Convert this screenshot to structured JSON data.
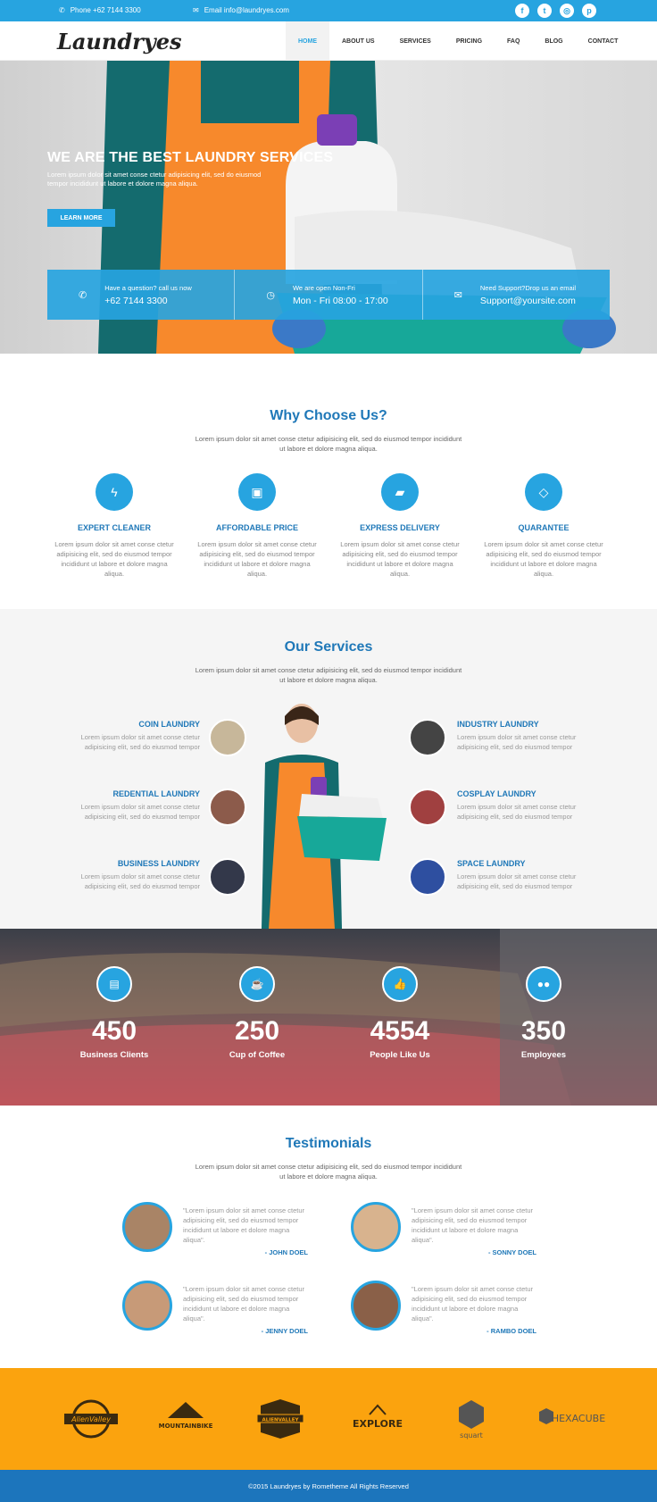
{
  "topbar": {
    "phone_label": "Phone +62 7144 3300",
    "email_label": "Email info@laundryes.com",
    "social": [
      "facebook-icon",
      "twitter-icon",
      "instagram-icon",
      "pinterest-icon"
    ]
  },
  "nav": {
    "logo": "Laundryes",
    "items": [
      "HOME",
      "ABOUT US",
      "SERVICES",
      "PRICING",
      "FAQ",
      "BLOG",
      "CONTACT"
    ],
    "active": "HOME"
  },
  "hero": {
    "title": "WE ARE THE BEST LAUNDRY SERVICES",
    "text": "Lorem ipsum dolor sit amet conse ctetur adipisicing elit, sed do eiusmod tempor incididunt ut labore et dolore magna aliqua.",
    "button": "LEARN MORE",
    "info": [
      {
        "icon": "phone-icon",
        "question": "Have a question? call us now",
        "value": "+62 7144 3300"
      },
      {
        "icon": "clock-icon",
        "question": "We are open Non-Fri",
        "value": "Mon - Fri 08:00 - 17:00"
      },
      {
        "icon": "envelope-icon",
        "question": "Need Support?Drop us an email",
        "value": "Support@yoursite.com"
      }
    ]
  },
  "why": {
    "title": "Why Choose Us?",
    "subtitle": "Lorem ipsum dolor sit amet conse ctetur adipisicing elit, sed do eiusmod tempor incididunt ut labore et dolore magna aliqua.",
    "features": [
      {
        "icon": "bolt-icon",
        "title": "EXPERT CLEANER",
        "text": "Lorem ipsum dolor sit amet conse ctetur adipisicing elit, sed do eiusmod tempor incididunt ut labore et dolore magna aliqua."
      },
      {
        "icon": "money-icon",
        "title": "AFFORDABLE PRICE",
        "text": "Lorem ipsum dolor sit amet conse ctetur adipisicing elit, sed do eiusmod tempor incididunt ut labore et dolore magna aliqua."
      },
      {
        "icon": "truck-icon",
        "title": "EXPRESS DELIVERY",
        "text": "Lorem ipsum dolor sit amet conse ctetur adipisicing elit, sed do eiusmod tempor incididunt ut labore et dolore magna aliqua."
      },
      {
        "icon": "diamond-icon",
        "title": "QUARANTEE",
        "text": "Lorem ipsum dolor sit amet conse ctetur adipisicing elit, sed do eiusmod tempor incididunt ut labore et dolore magna aliqua."
      }
    ]
  },
  "services": {
    "title": "Our Services",
    "subtitle": "Lorem ipsum dolor sit amet conse ctetur adipisicing elit, sed do eiusmod tempor incididunt ut labore et dolore magna aliqua.",
    "items": [
      {
        "title": "COIN LAUNDRY",
        "text": "Lorem ipsum dolor sit amet conse ctetur adipisicing elit, sed do eiusmod tempor"
      },
      {
        "title": "REDENTIAL LAUNDRY",
        "text": "Lorem ipsum dolor sit amet conse ctetur adipisicing elit, sed do eiusmod tempor"
      },
      {
        "title": "BUSINESS LAUNDRY",
        "text": "Lorem ipsum dolor sit amet conse ctetur adipisicing elit, sed do eiusmod tempor"
      },
      {
        "title": "INDUSTRY LAUNDRY",
        "text": "Lorem ipsum dolor sit amet conse ctetur adipisicing elit, sed do eiusmod tempor"
      },
      {
        "title": "COSPLAY LAUNDRY",
        "text": "Lorem ipsum dolor sit amet conse ctetur adipisicing elit, sed do eiusmod tempor"
      },
      {
        "title": "SPACE LAUNDRY",
        "text": "Lorem ipsum dolor sit amet conse ctetur adipisicing elit, sed do eiusmod tempor"
      }
    ]
  },
  "stats": [
    {
      "icon": "briefcase-icon",
      "number": "450",
      "label": "Business Clients"
    },
    {
      "icon": "coffee-icon",
      "number": "250",
      "label": "Cup of Coffee"
    },
    {
      "icon": "thumbs-up-icon",
      "number": "4554",
      "label": "People Like Us"
    },
    {
      "icon": "users-icon",
      "number": "350",
      "label": "Employees"
    }
  ],
  "testimonials": {
    "title": "Testimonials",
    "subtitle": "Lorem ipsum dolor sit amet conse ctetur adipisicing elit, sed do eiusmod tempor incididunt ut labore et dolore magna aliqua.",
    "items": [
      {
        "quote": "\"Lorem ipsum dolor sit amet conse ctetur adipisicing elit, sed do eiusmod tempor incididunt ut labore et dolore magna aliqua\".",
        "name": "- JOHN DOEL"
      },
      {
        "quote": "\"Lorem ipsum dolor sit amet conse ctetur adipisicing elit, sed do eiusmod tempor incididunt ut labore et dolore magna aliqua\".",
        "name": "- SONNY DOEL"
      },
      {
        "quote": "\"Lorem ipsum dolor sit amet conse ctetur adipisicing elit, sed do eiusmod tempor incididunt ut labore et dolore magna aliqua\".",
        "name": "- JENNY DOEL"
      },
      {
        "quote": "\"Lorem ipsum dolor sit amet conse ctetur adipisicing elit, sed do eiusmod tempor incididunt ut labore et dolore magna aliqua\".",
        "name": "- RAMBO DOEL"
      }
    ]
  },
  "brands": [
    "AlienValley",
    "MOUNTAINBIKE",
    "ALIENVALLEY",
    "EXPLORE",
    "squart",
    "HEXACUBE"
  ],
  "footer": {
    "text": "©2015 Laundryes by Rometheme All Rights Reserved"
  },
  "colors": {
    "accent": "#27a4e0",
    "heading": "#1f78b8",
    "brand_bar": "#fba30e",
    "footer": "#1c75bc"
  }
}
